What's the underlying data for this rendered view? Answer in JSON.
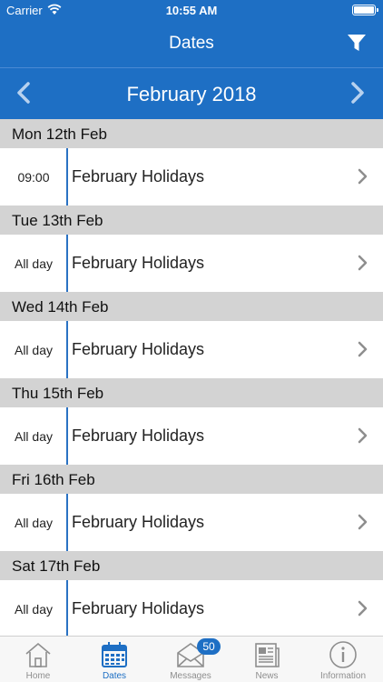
{
  "status_bar": {
    "carrier": "Carrier",
    "time": "10:55 AM"
  },
  "nav": {
    "title": "Dates",
    "filter_icon": "filter-icon"
  },
  "month_bar": {
    "month": "February 2018",
    "prev_icon": "chevron-left-icon",
    "next_icon": "chevron-right-icon"
  },
  "days": [
    {
      "header": "Mon 12th Feb",
      "time": "09:00",
      "event": "February Holidays"
    },
    {
      "header": "Tue 13th Feb",
      "time": "All day",
      "event": "February Holidays"
    },
    {
      "header": "Wed 14th Feb",
      "time": "All day",
      "event": "February Holidays"
    },
    {
      "header": "Thu 15th Feb",
      "time": "All day",
      "event": "February Holidays"
    },
    {
      "header": "Fri 16th Feb",
      "time": "All day",
      "event": "February Holidays"
    },
    {
      "header": "Sat 17th Feb",
      "time": "All day",
      "event": "February Holidays"
    }
  ],
  "tabs": [
    {
      "label": "Home",
      "icon": "home-icon"
    },
    {
      "label": "Dates",
      "icon": "calendar-icon",
      "active": true
    },
    {
      "label": "Messages",
      "icon": "envelope-icon",
      "badge": "50"
    },
    {
      "label": "News",
      "icon": "newspaper-icon"
    },
    {
      "label": "Information",
      "icon": "info-icon"
    }
  ],
  "colors": {
    "brand": "#1e6fc4",
    "day_header_bg": "#d3d3d3",
    "timeline": "#2a72c3",
    "tab_inactive": "#8e8e8e"
  }
}
